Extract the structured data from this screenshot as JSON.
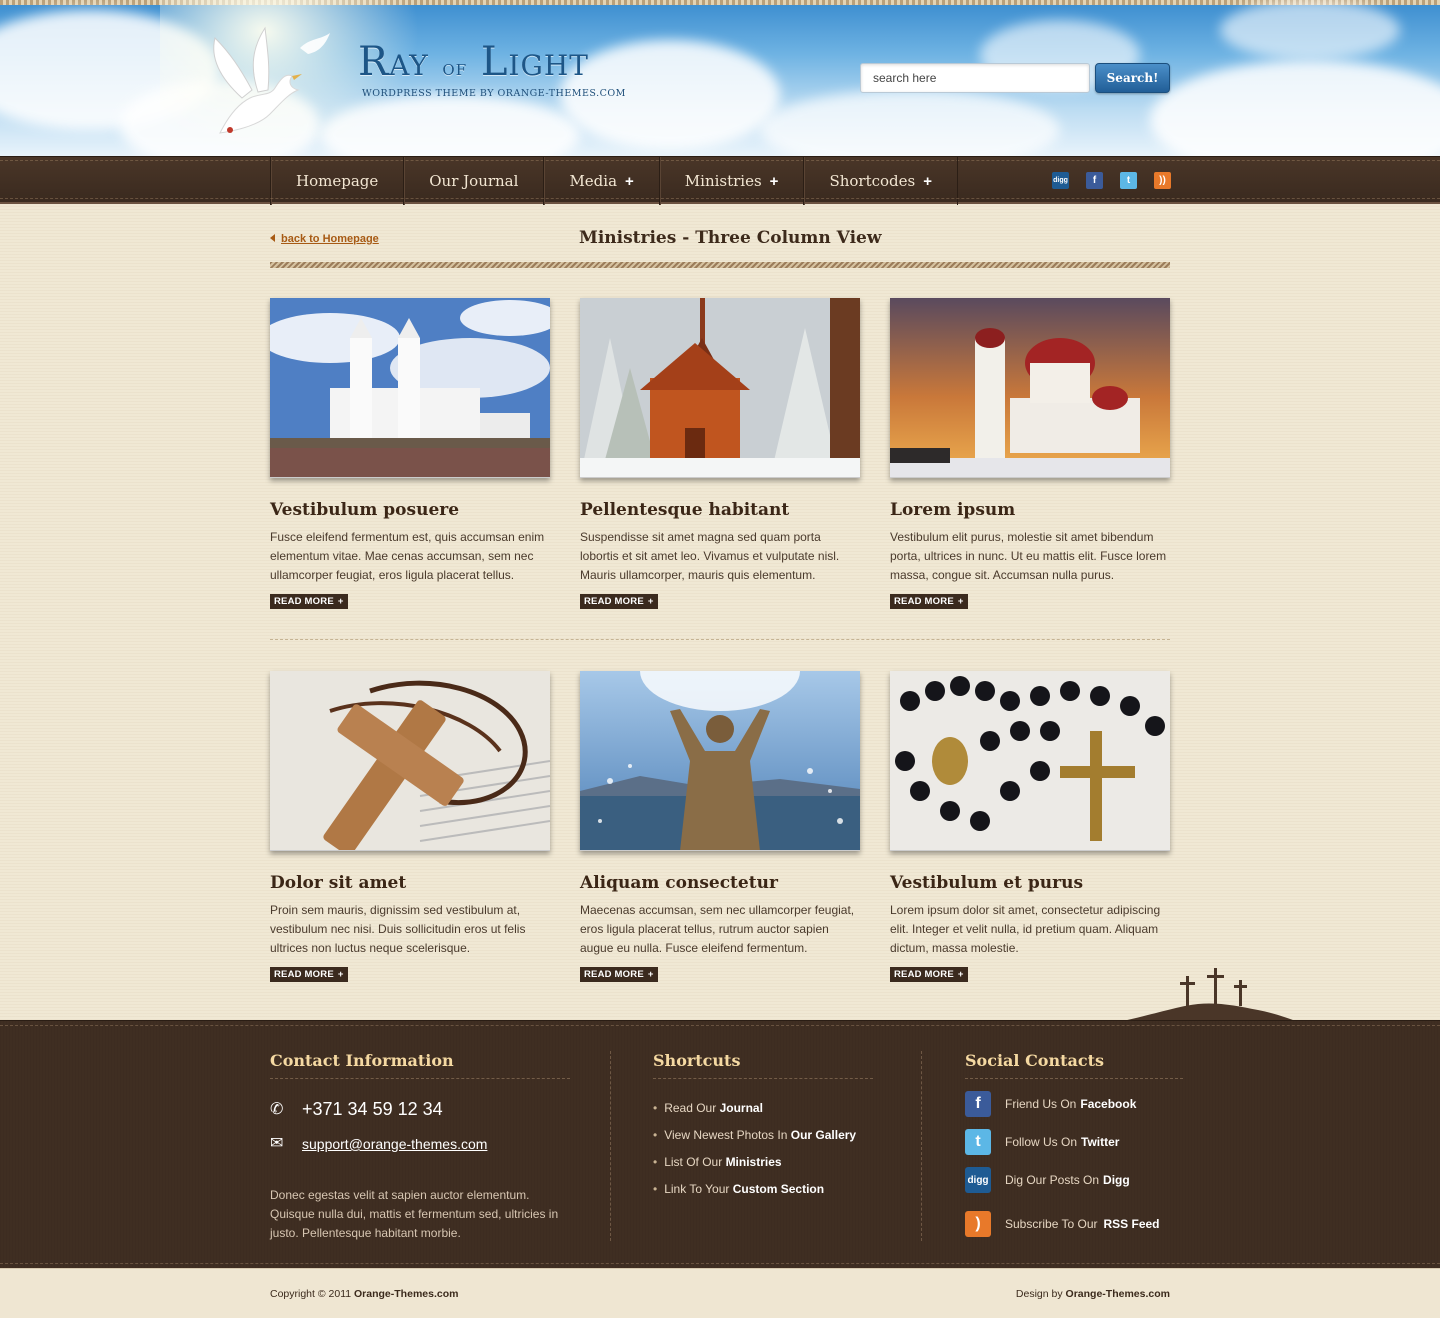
{
  "brand": {
    "title_ray": "Ray",
    "title_of": "of",
    "title_light": "Light",
    "subtitle": "WORDPRESS THEME BY ORANGE-THEMES.COM"
  },
  "search": {
    "value": "search here",
    "button_label": "Search!"
  },
  "nav": {
    "items": [
      {
        "label": "Homepage",
        "has_submenu": false
      },
      {
        "label": "Our Journal",
        "has_submenu": false
      },
      {
        "label": "Media",
        "has_submenu": true
      },
      {
        "label": "Ministries",
        "has_submenu": true
      },
      {
        "label": "Shortcodes",
        "has_submenu": true
      }
    ],
    "social_icons": [
      {
        "name": "digg-icon",
        "glyph": "digg"
      },
      {
        "name": "facebook-icon",
        "glyph": "f"
      },
      {
        "name": "twitter-icon",
        "glyph": "t"
      },
      {
        "name": "rss-icon",
        "glyph": "))"
      }
    ]
  },
  "main": {
    "back_link": "back to Homepage",
    "page_title": "Ministries - Three Column View",
    "read_more": "READ MORE",
    "cards": [
      {
        "title": "Vestibulum posuere",
        "text": "Fusce eleifend fermentum est, quis accumsan enim elementum vitae. Mae cenas accumsan, sem nec ullamcorper feugiat, eros ligula placerat tellus.",
        "image": "white-cathedral-photo"
      },
      {
        "title": "Pellentesque habitant",
        "text": "Suspendisse sit amet magna sed quam porta lobortis et sit amet leo. Vivamus et vulputate nisl. Mauris ullamcorper, mauris quis elementum.",
        "image": "red-chapel-snow-photo"
      },
      {
        "title": "Lorem ipsum",
        "text": "Vestibulum elit purus, molestie sit amet bibendum porta, ultrices in nunc. Ut eu mattis elit. Fusce lorem massa, congue sit. Accumsan nulla purus.",
        "image": "orthodox-church-sunset-photo"
      },
      {
        "title": "Dolor sit amet",
        "text": "Proin sem mauris, dignissim sed vestibulum at, vestibulum nec nisi. Duis sollicitudin eros ut felis ultrices non luctus neque scelerisque.",
        "image": "wooden-cross-bible-photo"
      },
      {
        "title": "Aliquam consectetur",
        "text": "Maecenas accumsan, sem nec ullamcorper feugiat, eros ligula placerat tellus, rutrum auctor sapien augue eu nulla. Fusce eleifend fermentum.",
        "image": "statue-raised-arms-photo"
      },
      {
        "title": "Vestibulum et purus",
        "text": "Lorem ipsum dolor sit amet, consectetur adipiscing elit. Integer et velit nulla, id pretium quam. Aliquam dictum, massa molestie.",
        "image": "rosary-beads-photo"
      }
    ]
  },
  "footer": {
    "contact": {
      "heading": "Contact Information",
      "phone": "+371 34 59 12 34",
      "email": "support@orange-themes.com",
      "description": "Donec egestas velit at sapien auctor elementum. Quisque nulla dui, mattis et fermentum sed, ultricies in justo. Pellentesque habitant morbie."
    },
    "shortcuts": {
      "heading": "Shortcuts",
      "items": [
        {
          "prefix": "Read Our",
          "bold": "Journal"
        },
        {
          "prefix": "View Newest Photos In",
          "bold": "Our Gallery"
        },
        {
          "prefix": "List Of Our",
          "bold": "Ministries"
        },
        {
          "prefix": "Link To Your",
          "bold": "Custom Section"
        }
      ]
    },
    "social": {
      "heading": "Social Contacts",
      "items": [
        {
          "prefix": "Friend Us On",
          "bold": "Facebook",
          "icon": "facebook-icon"
        },
        {
          "prefix": "Follow Us On",
          "bold": "Twitter",
          "icon": "twitter-icon"
        },
        {
          "prefix": "Dig Our Posts On",
          "bold": "Digg",
          "icon": "digg-icon"
        },
        {
          "prefix": "Subscribe To Our",
          "bold": "RSS Feed",
          "icon": "rss-icon"
        }
      ]
    }
  },
  "bottom": {
    "copyright_prefix": "Copyright © 2011",
    "copyright_site": "Orange-Themes.com",
    "design_prefix": "Design by",
    "design_site": "Orange-Themes.com"
  },
  "colors": {
    "nav_bg": "#3a2a1f",
    "content_bg": "#f0e8d4",
    "footer_bg": "#3f2e22",
    "heading_gold": "#f5d9a2",
    "link_orange": "#a75a14",
    "search_button": "#215e97"
  }
}
